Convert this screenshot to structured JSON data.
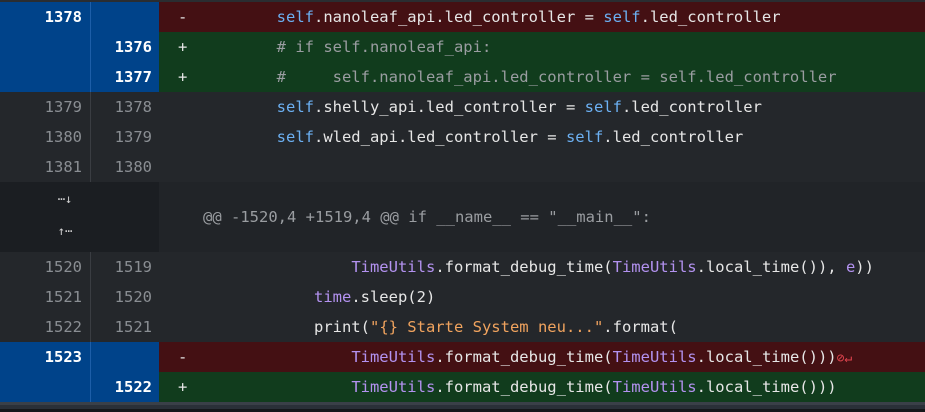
{
  "colors": {
    "selected": "#00438a",
    "deleted": "#441013",
    "added": "#113c1d",
    "context": "#24272b"
  },
  "icons": {
    "check": "check-icon",
    "expand_down": "expand-down-icon",
    "expand_up": "expand-up-icon",
    "no_newline": "no-newline-at-eof-icon"
  },
  "hunk_header": "@@ -1520,4 +1519,4 @@ if __name__ == \"__main__\":",
  "expand_down_glyph": "⋯↓",
  "expand_up_glyph": "↑⋯",
  "block1": [
    {
      "kind": "del",
      "selected": true,
      "check": "✓",
      "old": "1378",
      "new": "",
      "sign": "-",
      "tokens": [
        [
          "plain",
          "        "
        ],
        [
          "self",
          "self"
        ],
        [
          "plain",
          ".nanoleaf_api.led_controller = "
        ],
        [
          "self",
          "self"
        ],
        [
          "plain",
          ".led_controller"
        ]
      ]
    },
    {
      "kind": "add",
      "selected": true,
      "check": "✓",
      "old": "",
      "new": "1376",
      "sign": "+",
      "tokens": [
        [
          "com",
          "        # if self.nanoleaf_api:"
        ]
      ]
    },
    {
      "kind": "add",
      "selected": true,
      "check": "✓",
      "old": "",
      "new": "1377",
      "sign": "+",
      "tokens": [
        [
          "com",
          "        #     self.nanoleaf_api.led_controller = self.led_controller"
        ]
      ]
    },
    {
      "kind": "ctx",
      "selected": false,
      "old": "1379",
      "new": "1378",
      "sign": "",
      "tokens": [
        [
          "plain",
          "        "
        ],
        [
          "self",
          "self"
        ],
        [
          "plain",
          ".shelly_api.led_controller = "
        ],
        [
          "self",
          "self"
        ],
        [
          "plain",
          ".led_controller"
        ]
      ]
    },
    {
      "kind": "ctx",
      "selected": false,
      "old": "1380",
      "new": "1379",
      "sign": "",
      "tokens": [
        [
          "plain",
          "        "
        ],
        [
          "self",
          "self"
        ],
        [
          "plain",
          ".wled_api.led_controller = "
        ],
        [
          "self",
          "self"
        ],
        [
          "plain",
          ".led_controller"
        ]
      ]
    },
    {
      "kind": "ctx",
      "selected": false,
      "old": "1381",
      "new": "1380",
      "sign": "",
      "tokens": []
    }
  ],
  "block2": [
    {
      "kind": "ctx",
      "selected": false,
      "old": "1520",
      "new": "1519",
      "sign": "",
      "tokens": [
        [
          "plain",
          "                "
        ],
        [
          "cls",
          "TimeUtils"
        ],
        [
          "plain",
          ".format_debug_time("
        ],
        [
          "cls",
          "TimeUtils"
        ],
        [
          "plain",
          ".local_time()), "
        ],
        [
          "cls",
          "e"
        ],
        [
          "plain",
          "))"
        ]
      ]
    },
    {
      "kind": "ctx",
      "selected": false,
      "old": "1521",
      "new": "1520",
      "sign": "",
      "tokens": [
        [
          "plain",
          "            "
        ],
        [
          "cls",
          "time"
        ],
        [
          "plain",
          ".sleep(2)"
        ]
      ]
    },
    {
      "kind": "ctx",
      "selected": false,
      "old": "1522",
      "new": "1521",
      "sign": "",
      "tokens": [
        [
          "plain",
          "            print("
        ],
        [
          "str",
          "\"{} Starte System neu...\""
        ],
        [
          "plain",
          ".format("
        ]
      ]
    },
    {
      "kind": "del",
      "selected": true,
      "check": "✓",
      "old": "1523",
      "new": "",
      "sign": "-",
      "tokens": [
        [
          "plain",
          "                "
        ],
        [
          "cls",
          "TimeUtils"
        ],
        [
          "plain",
          ".format_debug_time("
        ],
        [
          "cls",
          "TimeUtils"
        ],
        [
          "plain",
          ".local_time()))"
        ],
        [
          "err",
          "⊘↵"
        ]
      ]
    },
    {
      "kind": "add",
      "selected": true,
      "check": "✓",
      "old": "",
      "new": "1522",
      "sign": "+",
      "tokens": [
        [
          "plain",
          "                "
        ],
        [
          "cls",
          "TimeUtils"
        ],
        [
          "plain",
          ".format_debug_time("
        ],
        [
          "cls",
          "TimeUtils"
        ],
        [
          "plain",
          ".local_time()))"
        ]
      ]
    }
  ]
}
